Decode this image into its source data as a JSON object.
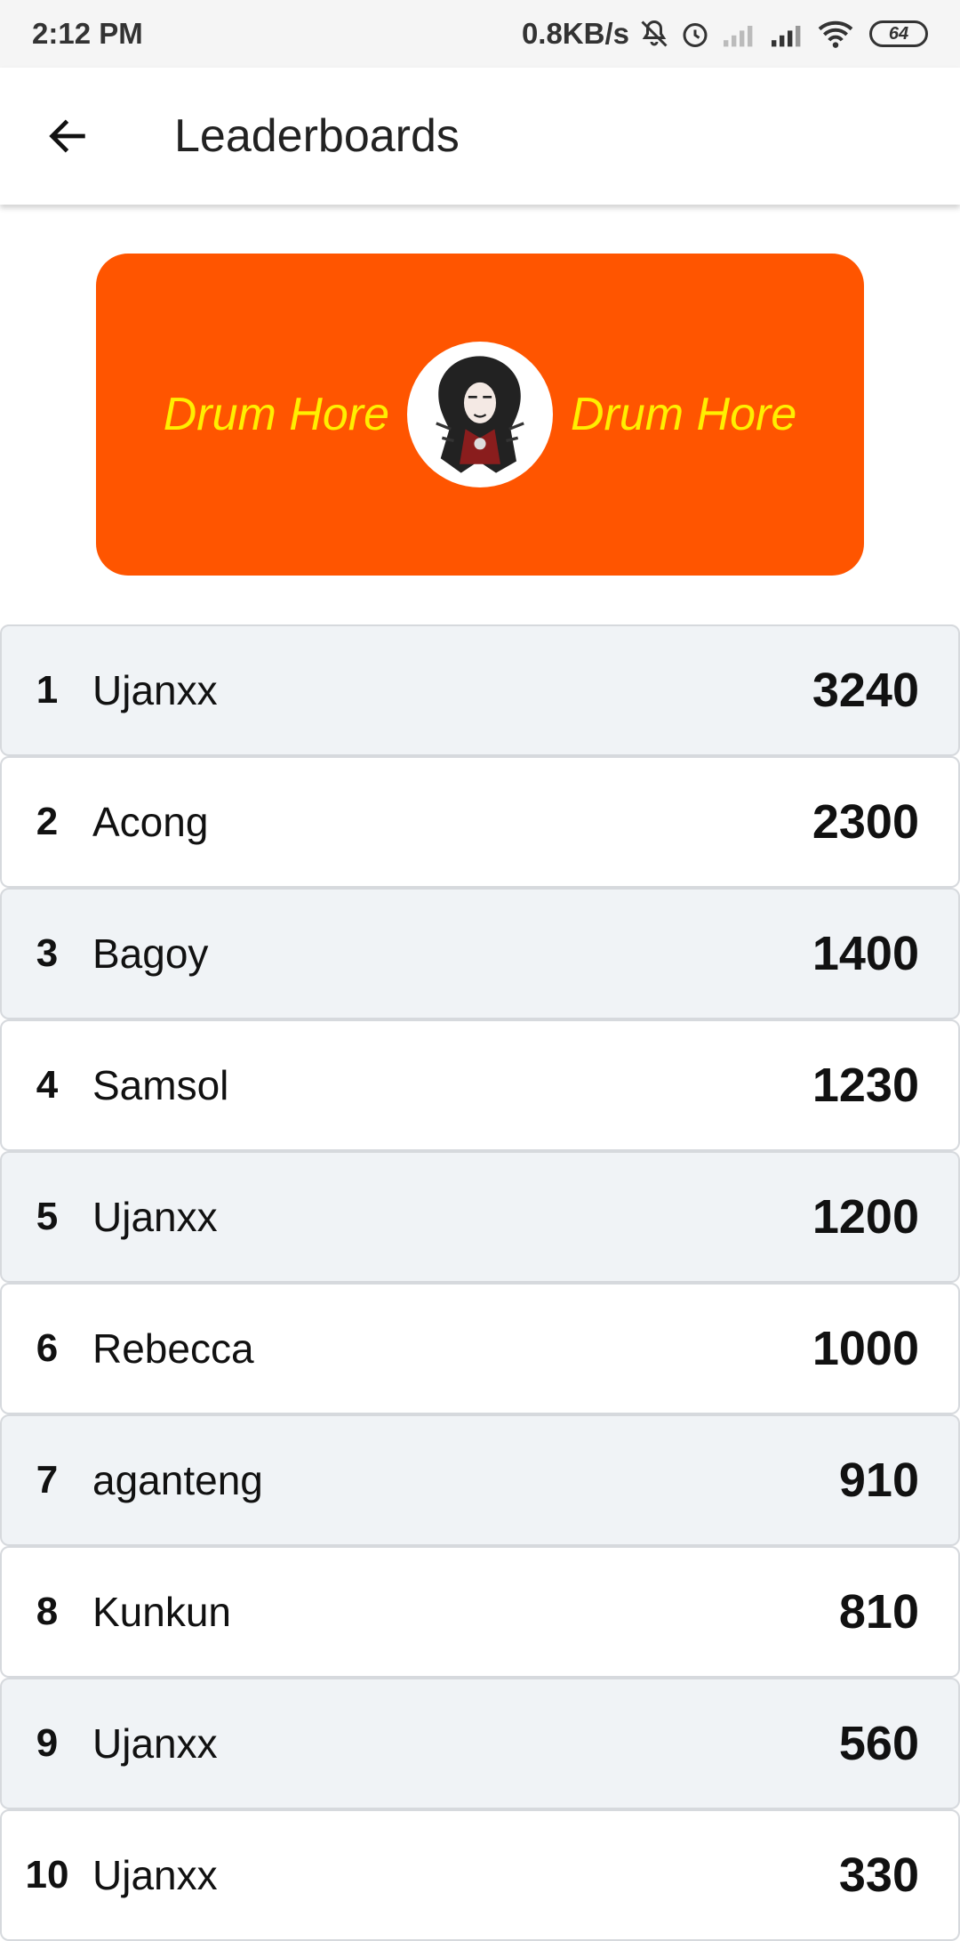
{
  "status_bar": {
    "time": "2:12 PM",
    "network_speed": "0.8KB/s",
    "battery": "64"
  },
  "app_bar": {
    "title": "Leaderboards"
  },
  "banner": {
    "left_text": "Drum Hore",
    "right_text": "Drum Hore",
    "background_color": "#ff5500",
    "text_color": "#ffef00"
  },
  "leaderboard": [
    {
      "rank": "1",
      "name": "Ujanxx",
      "score": "3240"
    },
    {
      "rank": "2",
      "name": "Acong",
      "score": "2300"
    },
    {
      "rank": "3",
      "name": "Bagoy",
      "score": "1400"
    },
    {
      "rank": "4",
      "name": "Samsol",
      "score": "1230"
    },
    {
      "rank": "5",
      "name": "Ujanxx",
      "score": "1200"
    },
    {
      "rank": "6",
      "name": "Rebecca",
      "score": "1000"
    },
    {
      "rank": "7",
      "name": "aganteng",
      "score": "910"
    },
    {
      "rank": "8",
      "name": "Kunkun",
      "score": "810"
    },
    {
      "rank": "9",
      "name": "Ujanxx",
      "score": "560"
    },
    {
      "rank": "10",
      "name": "Ujanxx",
      "score": "330"
    }
  ]
}
